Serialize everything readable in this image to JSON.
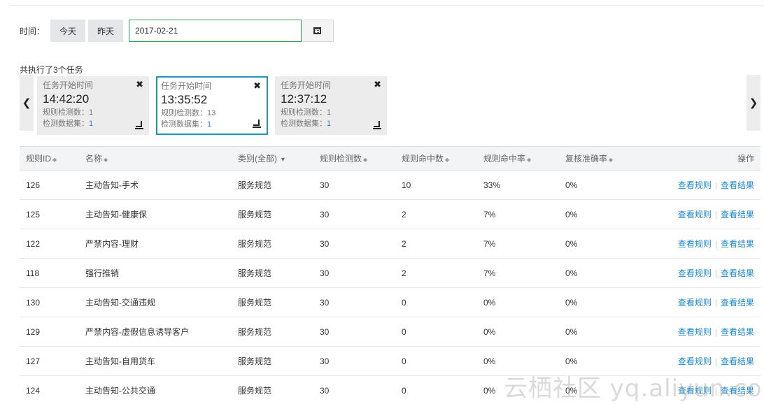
{
  "filter": {
    "time_label": "时间：",
    "today_button": "今天",
    "yesterday_button": "昨天",
    "date_value": "2017-02-21"
  },
  "tasks": {
    "summary": "共执行了3个任务",
    "cards": [
      {
        "title": "任务开始时间",
        "time": "14:42:20",
        "rules_label": "规则检测数：",
        "rules_count": "1",
        "datasets_label": "检测数据集：",
        "datasets_count": "1",
        "active": false
      },
      {
        "title": "任务开始时间",
        "time": "13:35:52",
        "rules_label": "规则检测数：",
        "rules_count": "13",
        "datasets_label": "检测数据集：",
        "datasets_count": "1",
        "active": true
      },
      {
        "title": "任务开始时间",
        "time": "12:37:12",
        "rules_label": "规则检测数：",
        "rules_count": "1",
        "datasets_label": "检测数据集：",
        "datasets_count": "1",
        "active": false
      }
    ]
  },
  "table": {
    "headers": {
      "rule_id": "规则ID",
      "name": "名称",
      "category": "类别(全部)",
      "detect_count": "规则检测数",
      "hit_count": "规则命中数",
      "hit_rate": "规则命中率",
      "review_accuracy": "复核准确率",
      "actions": "操作"
    },
    "view_rule_label": "查看规则",
    "view_result_label": "查看结果",
    "rows": [
      {
        "id": "126",
        "name": "主动告知-手术",
        "category": "服务规范",
        "detect": "30",
        "hit": "10",
        "rate": "33%",
        "accuracy": "0%"
      },
      {
        "id": "125",
        "name": "主动告知-健康保",
        "category": "服务规范",
        "detect": "30",
        "hit": "2",
        "rate": "7%",
        "accuracy": "0%"
      },
      {
        "id": "122",
        "name": "严禁内容-理财",
        "category": "服务规范",
        "detect": "30",
        "hit": "2",
        "rate": "7%",
        "accuracy": "0%"
      },
      {
        "id": "118",
        "name": "强行推销",
        "category": "服务规范",
        "detect": "30",
        "hit": "2",
        "rate": "7%",
        "accuracy": "0%"
      },
      {
        "id": "130",
        "name": "主动告知-交通违规",
        "category": "服务规范",
        "detect": "30",
        "hit": "0",
        "rate": "0%",
        "accuracy": "0%"
      },
      {
        "id": "129",
        "name": "严禁内容-虚假信息诱导客户",
        "category": "服务规范",
        "detect": "30",
        "hit": "0",
        "rate": "0%",
        "accuracy": "0%"
      },
      {
        "id": "127",
        "name": "主动告知-自用货车",
        "category": "服务规范",
        "detect": "30",
        "hit": "0",
        "rate": "0%",
        "accuracy": "0%"
      },
      {
        "id": "124",
        "name": "主动告知-公共交通",
        "category": "服务规范",
        "detect": "30",
        "hit": "0",
        "rate": "0%",
        "accuracy": "0%"
      }
    ]
  },
  "watermark": "云栖社区 yq.aliyun.com"
}
